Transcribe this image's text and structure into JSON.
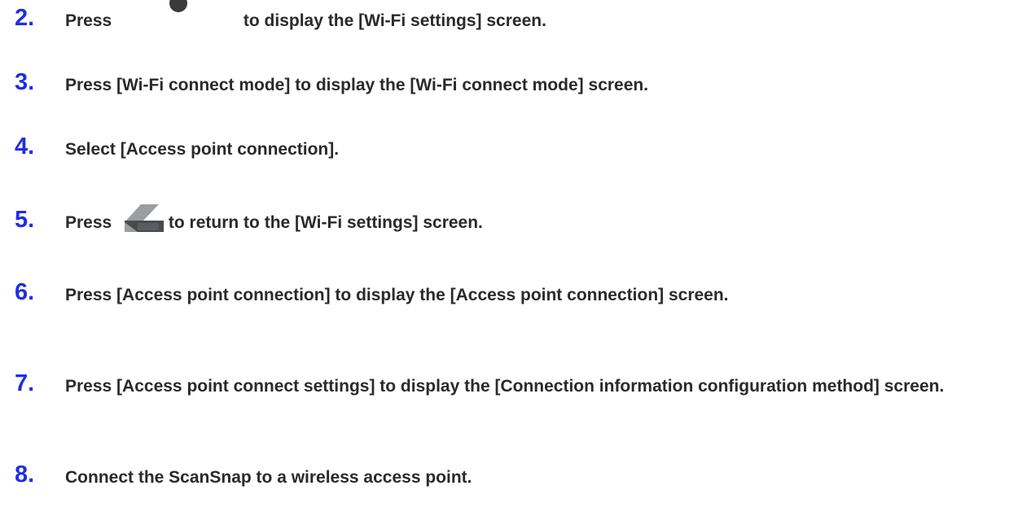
{
  "steps": [
    {
      "number": "2.",
      "before": "Press ",
      "icon": "home-circle-icon",
      "after": " to display the [Wi-Fi settings] screen."
    },
    {
      "number": "3.",
      "text": "Press [Wi-Fi connect mode] to display the [Wi-Fi connect mode] screen."
    },
    {
      "number": "4.",
      "text": "Select [Access point connection]."
    },
    {
      "number": "5.",
      "before": "Press ",
      "icon": "back-arrow-icon",
      "after": " to return to the [Wi-Fi settings] screen."
    },
    {
      "number": "6.",
      "text": "Press [Access point connection] to display the [Access point connection] screen."
    },
    {
      "number": "7.",
      "text": "Press [Access point connect settings] to display the [Connection information configuration method] screen."
    },
    {
      "number": "8.",
      "text": "Connect the ScanSnap to a wireless access point."
    }
  ],
  "colors": {
    "step_number": "#1f2ee6",
    "step_text": "#2a2a2a",
    "back_icon_bg": "#4a4a4a",
    "back_icon_fg": "#cfd2d4"
  }
}
